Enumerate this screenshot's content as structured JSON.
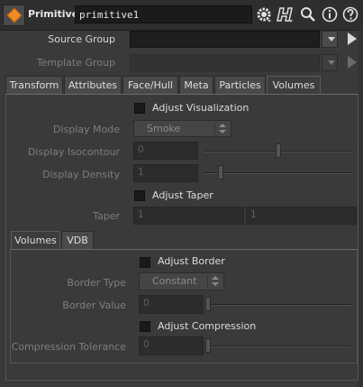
{
  "header": {
    "node_type": "Primitive",
    "node_name": "primitive1",
    "icons": [
      "gear-icon",
      "houdini-help-h-icon",
      "magnifier-icon",
      "info-icon",
      "help-question-icon"
    ]
  },
  "source_group": {
    "label": "Source Group",
    "value": ""
  },
  "template_group": {
    "label": "Template Group",
    "value": ""
  },
  "tabs": [
    {
      "label": "Transform"
    },
    {
      "label": "Attributes"
    },
    {
      "label": "Face/Hull"
    },
    {
      "label": "Meta"
    },
    {
      "label": "Particles"
    },
    {
      "label": "Volumes",
      "active": true
    }
  ],
  "volumes": {
    "adjust_visualization": {
      "label": "Adjust Visualization",
      "checked": false
    },
    "display_mode": {
      "label": "Display Mode",
      "value": "Smoke"
    },
    "display_isocontour": {
      "label": "Display Isocontour",
      "value": "0",
      "slider_fraction": 0.5
    },
    "display_density": {
      "label": "Display Density",
      "value": "1",
      "slider_fraction": 0.1
    },
    "adjust_taper": {
      "label": "Adjust Taper",
      "checked": false
    },
    "taper": {
      "label": "Taper",
      "x": "1",
      "y": "1"
    }
  },
  "subtabs": [
    {
      "label": "Volumes",
      "active": true
    },
    {
      "label": "VDB"
    }
  ],
  "subvolumes": {
    "adjust_border": {
      "label": "Adjust Border",
      "checked": false
    },
    "border_type": {
      "label": "Border Type",
      "value": "Constant"
    },
    "border_value": {
      "label": "Border Value",
      "value": "0",
      "slider_fraction": 0.0
    },
    "adjust_compression": {
      "label": "Adjust Compression",
      "checked": false
    },
    "compression_tolerance": {
      "label": "Compression Tolerance",
      "value": "0",
      "slider_fraction": 0.0
    }
  }
}
